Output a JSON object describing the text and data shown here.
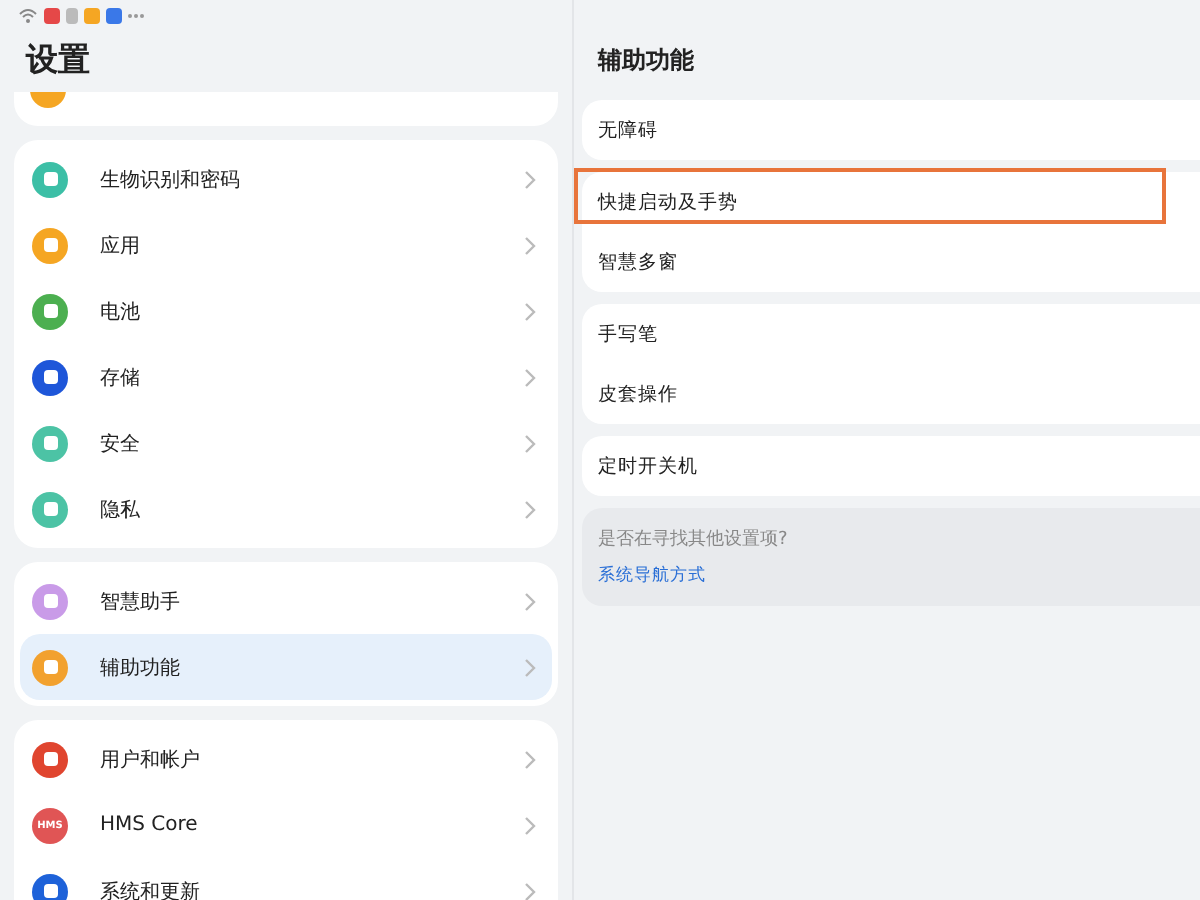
{
  "left": {
    "title": "设置",
    "groups": [
      {
        "items": [
          {
            "label": "生物识别和密码",
            "color": "#3cbfa6",
            "selected": false
          },
          {
            "label": "应用",
            "color": "#f5a623",
            "selected": false
          },
          {
            "label": "电池",
            "color": "#4caf50",
            "selected": false
          },
          {
            "label": "存储",
            "color": "#1e56d9",
            "selected": false
          },
          {
            "label": "安全",
            "color": "#4cc3a5",
            "selected": false
          },
          {
            "label": "隐私",
            "color": "#4cc3a5",
            "selected": false
          }
        ]
      },
      {
        "items": [
          {
            "label": "智慧助手",
            "color": "#c99be8",
            "selected": false
          },
          {
            "label": "辅助功能",
            "color": "#f2a12e",
            "selected": true
          }
        ]
      },
      {
        "items": [
          {
            "label": "用户和帐户",
            "color": "#e0452f",
            "selected": false
          },
          {
            "label": "HMS Core",
            "color": "#e05555",
            "icon_text": "HMS",
            "selected": false
          },
          {
            "label": "系统和更新",
            "color": "#1e62d9",
            "selected": false
          }
        ]
      }
    ]
  },
  "right": {
    "title": "辅助功能",
    "groups": [
      {
        "items": [
          {
            "label": "无障碍",
            "highlighted": false
          }
        ]
      },
      {
        "items": [
          {
            "label": "快捷启动及手势",
            "highlighted": true
          },
          {
            "label": "智慧多窗",
            "highlighted": false
          }
        ]
      },
      {
        "items": [
          {
            "label": "手写笔",
            "highlighted": false
          },
          {
            "label": "皮套操作",
            "highlighted": false
          }
        ]
      },
      {
        "items": [
          {
            "label": "定时开关机",
            "highlighted": false
          }
        ]
      }
    ],
    "hint": {
      "question": "是否在寻找其他设置项?",
      "link": "系统导航方式"
    }
  }
}
